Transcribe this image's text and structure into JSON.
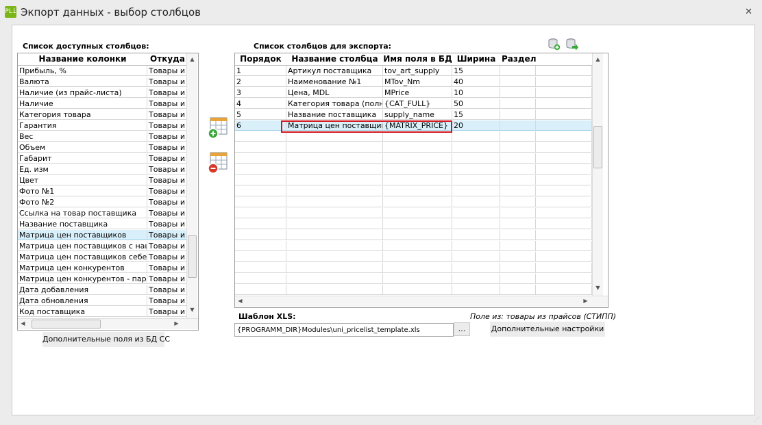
{
  "window": {
    "app_icon": "PLi",
    "title": "Экпорт данных - выбор столбцов",
    "close": "✕"
  },
  "available": {
    "label": "Список доступных столбцов:",
    "columns": [
      "Название колонки",
      "Откуда"
    ],
    "rows": [
      [
        "Прибыль, %",
        "Товары и"
      ],
      [
        "Валюта",
        "Товары и"
      ],
      [
        "Наличие (из прайс-листа)",
        "Товары и"
      ],
      [
        "Наличие",
        "Товары и"
      ],
      [
        "Категория товара",
        "Товары и"
      ],
      [
        "Гарантия",
        "Товары и"
      ],
      [
        "Вес",
        "Товары и"
      ],
      [
        "Объем",
        "Товары и"
      ],
      [
        "Габарит",
        "Товары и"
      ],
      [
        "Ед. изм",
        "Товары и"
      ],
      [
        "Цвет",
        "Товары и"
      ],
      [
        "Фото №1",
        "Товары и"
      ],
      [
        "Фото №2",
        "Товары и"
      ],
      [
        "Ссылка на товар поставщика",
        "Товары и"
      ],
      [
        "Название поставщика",
        "Товары и"
      ],
      [
        "Матрица цен поставщиков",
        "Товары и"
      ],
      [
        "Матрица цен поставщиков с наценко",
        "Товары и"
      ],
      [
        "Матрица цен поставщиков себестоим",
        "Товары и"
      ],
      [
        "Матрица цен конкурентов",
        "Товары и"
      ],
      [
        "Матрица цен конкурентов - парсер",
        "Товары и"
      ],
      [
        "Дата добавления",
        "Товары и"
      ],
      [
        "Дата обновления",
        "Товары и"
      ],
      [
        "Код поставщика",
        "Товары и"
      ]
    ],
    "selected_index": 15,
    "extra_button": "Дополнительные поля из БД СС"
  },
  "export": {
    "label": "Список столбцов для экспорта:",
    "columns": [
      "Порядок",
      "Название столбца",
      "Имя поля в БД",
      "Ширина",
      "Раздели"
    ],
    "rows": [
      [
        "1",
        "Артикул поставщика",
        "tov_art_supply",
        "15",
        ""
      ],
      [
        "2",
        "Наименование №1",
        "MTov_Nm",
        "40",
        ""
      ],
      [
        "3",
        "Цена, MDL",
        "MPrice",
        "10",
        ""
      ],
      [
        "4",
        "Категория товара (полная)",
        "{CAT_FULL}",
        "50",
        ""
      ],
      [
        "5",
        "Название поставщика",
        "supply_name",
        "15",
        ""
      ],
      [
        "6",
        "Матрица цен поставщиков",
        "{MATRIX_PRICE}",
        "20",
        ""
      ]
    ],
    "selected_index": 5
  },
  "template": {
    "label": "Шаблон XLS:",
    "path": "{PROGRAMM_DIR}Modules\\uni_pricelist_template.xls",
    "browse": "...",
    "source_info": "Поле из:   товары из прайсов (СТИПП)",
    "settings_button": "Дополнительные настройки"
  },
  "icons": {
    "add": "add-column-icon",
    "remove": "remove-column-icon",
    "db_add": "database-add-icon",
    "db_export": "database-export-icon"
  },
  "colors": {
    "selection": "#d9f0fb",
    "highlight": "#d4171f",
    "app_icon": "#7cb518"
  }
}
